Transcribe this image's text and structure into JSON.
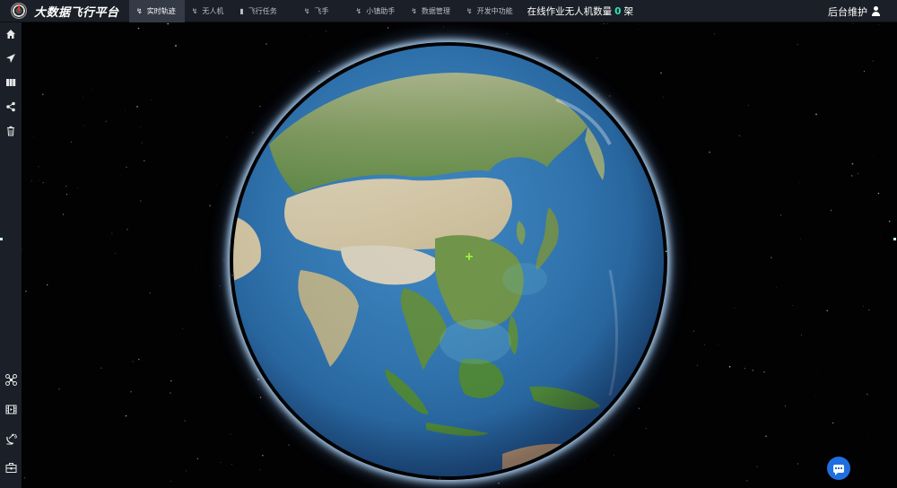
{
  "app": {
    "title": "大数据飞行平台",
    "logo_icon": "drone-platform-logo"
  },
  "nav": {
    "items": [
      {
        "label": "实时轨迹",
        "icon": "path-icon",
        "active": true
      },
      {
        "label": "无人机",
        "icon": "path-icon",
        "active": false
      },
      {
        "label": "飞行任务",
        "icon": "task-icon",
        "active": false
      },
      {
        "label": "飞手",
        "icon": "path-icon",
        "active": false
      },
      {
        "label": "小镇助手",
        "icon": "path-icon",
        "active": false
      },
      {
        "label": "数据管理",
        "icon": "path-icon",
        "active": false
      },
      {
        "label": "开发中功能",
        "icon": "path-icon",
        "active": false
      }
    ]
  },
  "status": {
    "online_prefix": "在线作业无人机数量",
    "online_count": "0",
    "online_suffix": "架"
  },
  "header": {
    "admin_label": "后台维护",
    "admin_icon": "user-icon"
  },
  "sidebar": {
    "top_icons": [
      "home-icon",
      "send-icon",
      "columns-icon",
      "share-icon",
      "trash-icon"
    ],
    "bottom_icons": [
      "drone-icon",
      "film-icon",
      "satellite-dish-icon",
      "toolbox-icon"
    ]
  },
  "viewer": {
    "scene": "3d-earth-globe",
    "chat_icon": "chat-icon",
    "marker_color": "#9cff3a"
  },
  "colors": {
    "topbar_bg": "#1b1f27",
    "active_tab_bg": "#343a46",
    "count_color": "#2ee6b8",
    "chat_button": "#1f6fe0"
  }
}
